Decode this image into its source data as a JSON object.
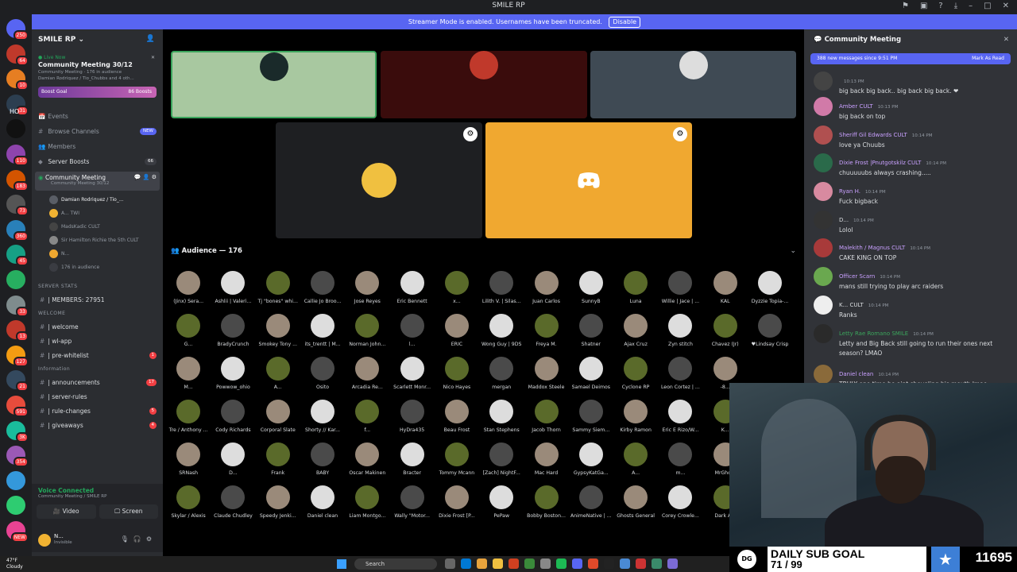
{
  "window": {
    "title": "SMILE RP"
  },
  "streamer_bar": {
    "text": "Streamer Mode is enabled. Usernames have been truncated.",
    "button": "Disable"
  },
  "server_list": [
    {
      "badge": "250",
      "color": "#5865f2"
    },
    {
      "badge": "64",
      "color": "#c0392b"
    },
    {
      "badge": "10",
      "color": "#e67e22"
    },
    {
      "badge": "31",
      "color": "#2c3e50"
    },
    {
      "badge": "",
      "color": "#111"
    },
    {
      "badge": "110",
      "color": "#8e44ad"
    },
    {
      "badge": "183",
      "color": "#d35400"
    },
    {
      "badge": "73",
      "color": "#555"
    },
    {
      "badge": "360",
      "color": "#2980b9"
    },
    {
      "badge": "45",
      "color": "#16a085"
    },
    {
      "badge": "",
      "color": "#27ae60"
    },
    {
      "badge": "33",
      "color": "#7f8c8d"
    },
    {
      "badge": "13",
      "color": "#c0392b"
    },
    {
      "badge": "127",
      "color": "#f39c12"
    },
    {
      "badge": "21",
      "color": "#34495e"
    },
    {
      "badge": "591",
      "color": "#e74c3c"
    },
    {
      "badge": "3K",
      "color": "#1abc9c"
    },
    {
      "badge": "354",
      "color": "#9b59b6"
    },
    {
      "badge": "",
      "color": "#3498db"
    },
    {
      "badge": "",
      "color": "#2ecc71"
    },
    {
      "badge": "NEW",
      "color": "#e84393"
    }
  ],
  "server_list_label_ho": "HO",
  "server": {
    "name": "SMILE RP"
  },
  "live": {
    "label": "Live Now",
    "title": "Community Meeting 30/12",
    "meta": "Community Meeting · 176 in audience",
    "speakers": "Damian Rodriquez / Tio_Chubbs and 4 oth..."
  },
  "boost": {
    "label": "Boost Goal",
    "count": "86 Boosts"
  },
  "nav": [
    {
      "icon": "📅",
      "label": "Events",
      "badge": ""
    },
    {
      "icon": "#",
      "label": "Browse Channels",
      "badge": "NEW"
    },
    {
      "icon": "👥",
      "label": "Members",
      "badge": ""
    },
    {
      "icon": "◆",
      "label": "Server Boosts",
      "badge": "66"
    }
  ],
  "stage_channel": {
    "name": "Community Meeting",
    "sub": "Community Meeting 30/12"
  },
  "stage_members": [
    "Damian Rodriquez / Tio_...",
    "A... TWI",
    "MadsKadic CULT",
    "Sir Hamilton Richie the 5th CULT",
    "N...",
    "176 in audience"
  ],
  "categories": [
    {
      "label": "SERVER STATS",
      "channels": [
        {
          "name": "| MEMBERS: 27951",
          "badge": ""
        }
      ]
    },
    {
      "label": "WELCOME",
      "channels": [
        {
          "name": "| welcome",
          "badge": ""
        },
        {
          "name": "| wl-app",
          "badge": ""
        },
        {
          "name": "| pre-whitelist",
          "badge": "1"
        }
      ]
    },
    {
      "label": "Information",
      "channels": [
        {
          "name": "| announcements",
          "badge": "17"
        },
        {
          "name": "| server-rules",
          "badge": ""
        },
        {
          "name": "| rule-changes",
          "badge": "5"
        },
        {
          "name": "| giveaways",
          "badge": "4"
        }
      ]
    }
  ],
  "voice": {
    "status": "Voice Connected",
    "location": "Community Meeting / SMILE RP",
    "video": "Video",
    "screen": "Screen"
  },
  "user": {
    "name": "N...",
    "status": "Invisible"
  },
  "tiles": [
    {
      "bg": "#a8c8a0",
      "face": "#1a2a2a",
      "border": "#3ba55c"
    },
    {
      "bg": "#3a0c0c",
      "face": "#c0392b",
      "border": ""
    },
    {
      "bg": "#3f4a54",
      "face": "#ddd",
      "border": ""
    },
    {
      "bg": "#1e1f22",
      "face": "#f0c040",
      "border": ""
    },
    {
      "bg": "#f0a830",
      "face": "",
      "border": ""
    }
  ],
  "audience": {
    "title": "Audience — 176",
    "members": [
      "(Jinx) Sera...",
      "Ashlii | Valeri...",
      "Tj \"bones\" whi...",
      "Callie Jo Broo...",
      "Jose Reyes",
      "Eric Bennett",
      "x...",
      "Lilith V. | Silas...",
      "Juan Carlos",
      "SunnyB",
      "Luna",
      "Willie | Jace | ...",
      "KAL",
      "Dyzzie Topia-...",
      "G...",
      "BradyCrunch",
      "Smokey Tony ...",
      "its_trentt | M...",
      "Norman John...",
      "l...",
      "ERIC",
      "Wong Guy | 9DS",
      "Freya M.",
      "Shatner",
      "Ajax Cruz",
      "Zyn stitch",
      "Chavez (Jr)",
      "♥Lindsay Crisp",
      "M...",
      "Powwow_ohio",
      "A...",
      "Osito",
      "Arcadia Re...",
      "Scarlett Monr...",
      "Nico Hayes",
      "mergan",
      "Maddox Steele",
      "Samael Deimos",
      "Cyclone RP",
      "Leon Cortez | ...",
      "-8...",
      "",
      "Tre / Anthony ...",
      "Cody Richards",
      "Corporal Slate",
      "Shorty // Kar...",
      "f...",
      "HyDra435",
      "Beau Frost",
      "Stan Stephens",
      "Jacob Thorn",
      "Sammy Siem...",
      "Kirby Ramon",
      "Eric E Rizo/W...",
      "K...",
      "",
      "SRNash",
      "D...",
      "Frank",
      "BABY",
      "Oscar Makinen",
      "Bracter",
      "Tommy Mcann",
      "[Zach] NightF...",
      "Mac Hard",
      "GypsyKatGa...",
      "A...",
      "m...",
      "MrGho...",
      "",
      "Skylar / Alexis",
      "Claude Chudley",
      "Speedy Jenki...",
      "Daniel clean",
      "Liam Montgo...",
      "Wally \"Motor...",
      "Dixie Frost [P...",
      "PePaw",
      "Bobby Boston...",
      "AnimeNative | ...",
      "Ghosts General",
      "Corey Crowle...",
      "Dark A...",
      ""
    ]
  },
  "chat": {
    "title": "Community Meeting",
    "new_messages": "388 new messages since 9:51 PM",
    "mark_read": "Mark As Read",
    "messages": [
      {
        "user": "",
        "time": "10:13 PM",
        "text": "big back big back.. big back big back. ❤",
        "color": "#dbdee1",
        "avatar": "#444"
      },
      {
        "user": "Amber CULT",
        "time": "10:13 PM",
        "text": "big back on top",
        "color": "#c9a0ff",
        "avatar": "#d17aa8"
      },
      {
        "user": "Sheriff Gil Edwards CULT",
        "time": "10:14 PM",
        "text": "love ya Chuubs",
        "color": "#c9a0ff",
        "avatar": "#b05050"
      },
      {
        "user": "Dixie Frost |Pnutgotskilz CULT",
        "time": "10:14 PM",
        "text": "chuuuuubs always crashing.....",
        "color": "#c9a0ff",
        "avatar": "#2a6a4a"
      },
      {
        "user": "Ryan H.",
        "time": "10:14 PM",
        "text": "Fuck bigback",
        "color": "#c9a0ff",
        "avatar": "#d88aa0"
      },
      {
        "user": "D...",
        "time": "10:14 PM",
        "text": "Lolol",
        "color": "#dbdee1",
        "avatar": "#333"
      },
      {
        "user": "Malekith / Magnus CULT",
        "time": "10:14 PM",
        "text": "CAKE KING ON TOP",
        "color": "#c9a0ff",
        "avatar": "#a83a3a"
      },
      {
        "user": "Officer Scarn",
        "time": "10:14 PM",
        "text": "mans still trying to play arc raiders",
        "color": "#c9a0ff",
        "avatar": "#6aa84f"
      },
      {
        "user": "K... CULT",
        "time": "10:14 PM",
        "text": "Ranks",
        "color": "#dbdee1",
        "avatar": "#eee"
      },
      {
        "user": "Letty Rae Romano SMILE",
        "time": "10:14 PM",
        "text": "Letty and Big Back still going to run their ones next",
        "color": "#3ba55c",
        "avatar": "#2a2a2a"
      },
      {
        "user": "",
        "time": "",
        "text": "season? LMAO",
        "color": "#dbdee1",
        "avatar": ""
      },
      {
        "user": "Daniel clean",
        "time": "10:14 PM",
        "text": "TRULY one time he aint shoveling his mouth lmao",
        "color": "#c9a0ff",
        "avatar": "#8a6a3a"
      }
    ]
  },
  "sub_goal": {
    "logo": "DG",
    "line1": "DAILY SUB GOAL",
    "line2": "71 / 99",
    "count": "11695"
  },
  "taskbar": {
    "temp": "47°F",
    "weather": "Cloudy",
    "search": "Search"
  }
}
